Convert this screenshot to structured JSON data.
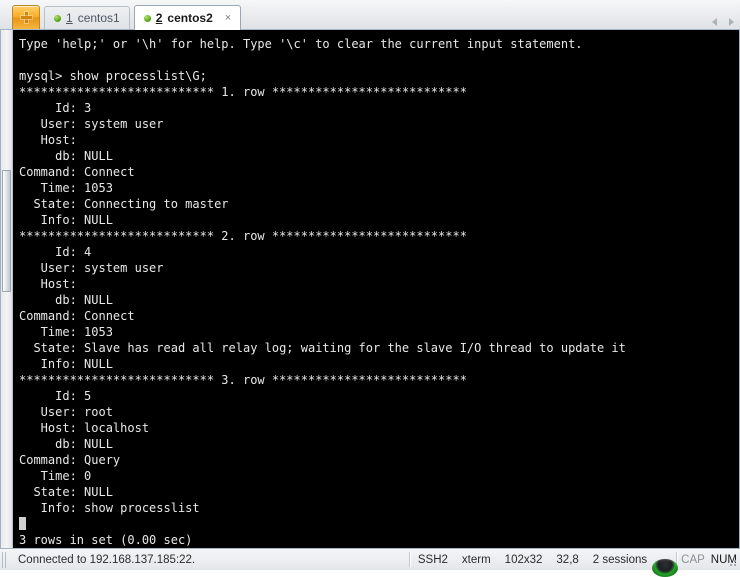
{
  "window": {
    "background_color": "#e6e8eb"
  },
  "tab_bar": {
    "new_tab_icon": "plus-icon",
    "new_tab_tooltip": "New Tab",
    "tabs": [
      {
        "index": "1",
        "label": "centos1",
        "active": false,
        "status_icon": "green-dot-icon",
        "closable": false
      },
      {
        "index": "2",
        "label": "centos2",
        "active": true,
        "status_icon": "green-dot-icon",
        "closable": true,
        "close_label": "×"
      }
    ],
    "scroll_left_icon": "chevron-left-icon",
    "scroll_right_icon": "chevron-right-icon"
  },
  "terminal": {
    "background_color": "#000000",
    "foreground_color": "#e8e8e8",
    "prompt": "mysql>",
    "command": "show processlist\\G;",
    "lines": [
      "Type 'help;' or '\\h' for help. Type '\\c' to clear the current input statement.",
      "",
      "mysql> show processlist\\G;",
      "*************************** 1. row ***************************",
      "     Id: 3",
      "   User: system user",
      "   Host: ",
      "     db: NULL",
      "Command: Connect",
      "   Time: 1053",
      "  State: Connecting to master",
      "   Info: NULL",
      "*************************** 2. row ***************************",
      "     Id: 4",
      "   User: system user",
      "   Host: ",
      "     db: NULL",
      "Command: Connect",
      "   Time: 1053",
      "  State: Slave has read all relay log; waiting for the slave I/O thread to update it",
      "   Info: NULL",
      "*************************** 3. row ***************************",
      "     Id: 5",
      "   User: root",
      "   Host: localhost",
      "     db: NULL",
      "Command: Query",
      "   Time: 0",
      "  State: NULL",
      "   Info: show processlist",
      "3 rows in set (0.00 sec)"
    ],
    "scrollbar": {
      "orientation": "vertical",
      "position": "left"
    }
  },
  "status_bar": {
    "connection": "Connected to 192.168.137.185:22.",
    "protocol": "SSH2",
    "terminal_type": "xterm",
    "dimensions": "102x32",
    "cursor_position": "32,8",
    "sessions": "2 sessions",
    "session_icon": "network-orb-icon",
    "caps_lock": "CAP",
    "num_lock": "NUM",
    "resize_grip_icon": "resize-grip-icon"
  }
}
